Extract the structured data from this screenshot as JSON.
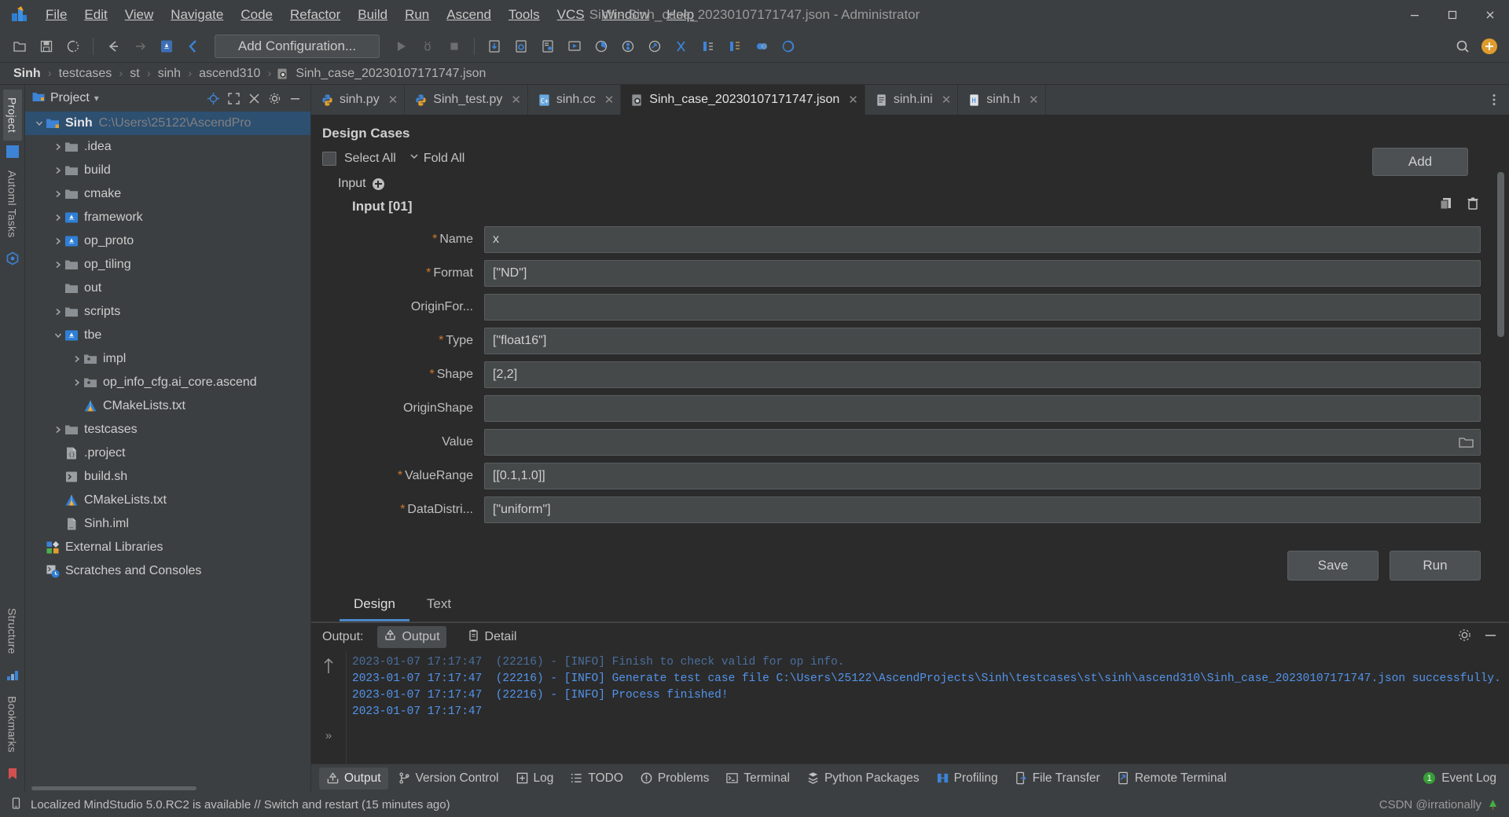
{
  "window": {
    "title": "Sinh - Sinh_case_20230107171747.json - Administrator",
    "minimize": "─",
    "maximize": "☐",
    "close": "✕"
  },
  "menu": [
    {
      "label": "File"
    },
    {
      "label": "Edit"
    },
    {
      "label": "View"
    },
    {
      "label": "Navigate"
    },
    {
      "label": "Code"
    },
    {
      "label": "Refactor"
    },
    {
      "label": "Build"
    },
    {
      "label": "Run"
    },
    {
      "label": "Ascend"
    },
    {
      "label": "Tools"
    },
    {
      "label": "VCS"
    },
    {
      "label": "Window"
    },
    {
      "label": "Help"
    }
  ],
  "toolbar": {
    "run_config": "Add Configuration...",
    "icons": [
      "open-project-icon",
      "save-all-icon",
      "sync-icon",
      "back-arrow-icon",
      "forward-arrow-icon",
      "ascend-project-icon",
      "build-hammer-icon"
    ],
    "right_icons": [
      "search-everywhere-icon",
      "ide-account-icon"
    ]
  },
  "breadcrumb": {
    "items": [
      "Sinh",
      "testcases",
      "st",
      "sinh",
      "ascend310",
      "Sinh_case_20230107171747.json"
    ],
    "separator": "›"
  },
  "left_rail": {
    "project_tab": "Project",
    "automl_tab": "Automl Tasks",
    "structure_tab": "Structure",
    "bookmarks_tab": "Bookmarks"
  },
  "project_pane": {
    "title": "Project",
    "dropdown": "▾",
    "header_icons": [
      "locate-icon",
      "expand-icon",
      "collapse-all-icon",
      "settings-gear-icon",
      "hide-icon"
    ],
    "tree": [
      {
        "label": "Sinh",
        "path": "C:\\Users\\25122\\AscendPro",
        "indent": 0,
        "arrow": "down",
        "icon": "module-folder-icon",
        "selected": true,
        "bold": true
      },
      {
        "label": ".idea",
        "indent": 1,
        "arrow": "right",
        "icon": "folder-icon"
      },
      {
        "label": "build",
        "indent": 1,
        "arrow": "right",
        "icon": "folder-icon"
      },
      {
        "label": "cmake",
        "indent": 1,
        "arrow": "right",
        "icon": "folder-icon"
      },
      {
        "label": "framework",
        "indent": 1,
        "arrow": "right",
        "icon": "source-root-icon"
      },
      {
        "label": "op_proto",
        "indent": 1,
        "arrow": "right",
        "icon": "source-root-icon"
      },
      {
        "label": "op_tiling",
        "indent": 1,
        "arrow": "right",
        "icon": "folder-icon"
      },
      {
        "label": "out",
        "indent": 1,
        "arrow": "none",
        "icon": "folder-icon"
      },
      {
        "label": "scripts",
        "indent": 1,
        "arrow": "right",
        "icon": "folder-icon"
      },
      {
        "label": "tbe",
        "indent": 1,
        "arrow": "down",
        "icon": "source-root-icon"
      },
      {
        "label": "impl",
        "indent": 2,
        "arrow": "right",
        "icon": "package-folder-icon"
      },
      {
        "label": "op_info_cfg.ai_core.ascend",
        "indent": 2,
        "arrow": "right",
        "icon": "package-folder-icon"
      },
      {
        "label": "CMakeLists.txt",
        "indent": 2,
        "arrow": "none",
        "icon": "cmake-file-icon"
      },
      {
        "label": "testcases",
        "indent": 1,
        "arrow": "right",
        "icon": "folder-icon"
      },
      {
        "label": ".project",
        "indent": 1,
        "arrow": "none",
        "icon": "xml-file-icon"
      },
      {
        "label": "build.sh",
        "indent": 1,
        "arrow": "none",
        "icon": "shell-file-icon"
      },
      {
        "label": "CMakeLists.txt",
        "indent": 1,
        "arrow": "none",
        "icon": "cmake-file-icon"
      },
      {
        "label": "Sinh.iml",
        "indent": 1,
        "arrow": "none",
        "icon": "iml-file-icon"
      },
      {
        "label": "External Libraries",
        "indent": 0,
        "arrow": "none",
        "icon": "external-libraries-icon"
      },
      {
        "label": "Scratches and Consoles",
        "indent": 0,
        "arrow": "none",
        "icon": "scratches-icon"
      }
    ]
  },
  "editor_tabs": [
    {
      "label": "sinh.py",
      "icon": "python-file-icon",
      "active": false
    },
    {
      "label": "Sinh_test.py",
      "icon": "python-file-icon",
      "active": false
    },
    {
      "label": "sinh.cc",
      "icon": "cpp-file-icon",
      "active": false
    },
    {
      "label": "Sinh_case_20230107171747.json",
      "icon": "ascend-json-icon",
      "active": true
    },
    {
      "label": "sinh.ini",
      "icon": "ini-file-icon",
      "active": false
    },
    {
      "label": "sinh.h",
      "icon": "header-file-icon",
      "active": false
    }
  ],
  "design": {
    "title": "Design Cases",
    "select_all": "Select All",
    "fold_all": "Fold All",
    "add_button": "Add",
    "group_label": "Input",
    "block_title": "Input [01]",
    "fields": [
      {
        "label": "Name",
        "required": true,
        "value": "x",
        "has_browse": false
      },
      {
        "label": "Format",
        "required": true,
        "value": "[\"ND\"]",
        "has_browse": false
      },
      {
        "label": "OriginFor...",
        "required": false,
        "value": "",
        "has_browse": false
      },
      {
        "label": "Type",
        "required": true,
        "value": "[\"float16\"]",
        "has_browse": false
      },
      {
        "label": "Shape",
        "required": true,
        "value": "[2,2]",
        "has_browse": false
      },
      {
        "label": "OriginShape",
        "required": false,
        "value": "",
        "has_browse": false
      },
      {
        "label": "Value",
        "required": false,
        "value": "",
        "has_browse": true
      },
      {
        "label": "ValueRange",
        "required": true,
        "value": "[[0.1,1.0]]",
        "has_browse": false
      },
      {
        "label": "DataDistri...",
        "required": true,
        "value": "[\"uniform\"]",
        "has_browse": false
      }
    ],
    "save_button": "Save",
    "run_button": "Run",
    "view_tabs": [
      {
        "label": "Design",
        "active": true
      },
      {
        "label": "Text",
        "active": false
      }
    ]
  },
  "output": {
    "label": "Output:",
    "tab_output": "Output",
    "tab_detail": "Detail",
    "lines": [
      {
        "text": "2023-01-07 17:17:47  (22216) - [INFO] Finish to check valid for op info.",
        "dim": true
      },
      {
        "text": "2023-01-07 17:17:47  (22216) - [INFO] Generate test case file C:\\Users\\25122\\AscendProjects\\Sinh\\testcases\\st\\sinh\\ascend310\\Sinh_case_20230107171747.json successfully.",
        "dim": false
      },
      {
        "text": "2023-01-07 17:17:47  (22216) - [INFO] Process finished!",
        "dim": false
      },
      {
        "text": "2023-01-07 17:17:47",
        "dim": false
      }
    ],
    "gutter_chevrons": "»",
    "right_icons": [
      "settings-gear-icon",
      "hide-panel-icon"
    ]
  },
  "bottom_tabs": [
    {
      "label": "Output",
      "icon": "output-arrow-icon",
      "active": true
    },
    {
      "label": "Version Control",
      "icon": "branch-icon",
      "active": false
    },
    {
      "label": "Log",
      "icon": "log-icon",
      "active": false
    },
    {
      "label": "TODO",
      "icon": "todo-list-icon",
      "active": false
    },
    {
      "label": "Problems",
      "icon": "problems-icon",
      "active": false
    },
    {
      "label": "Terminal",
      "icon": "terminal-icon",
      "active": false
    },
    {
      "label": "Python Packages",
      "icon": "python-packages-icon",
      "active": false
    },
    {
      "label": "Profiling",
      "icon": "profiling-icon",
      "active": false
    },
    {
      "label": "File Transfer",
      "icon": "file-transfer-icon",
      "active": false
    },
    {
      "label": "Remote Terminal",
      "icon": "remote-terminal-icon",
      "active": false
    }
  ],
  "event_log": {
    "label": "Event Log",
    "badge": "1"
  },
  "statusbar": {
    "message": "Localized MindStudio 5.0.RC2 is available // Switch and restart (15 minutes ago)",
    "watermark": "CSDN @irrationally"
  },
  "colors": {
    "accent_blue": "#4a88c7",
    "required_orange": "#cc7832",
    "console_blue": "#5394ec",
    "selection_blue": "#2d4f70",
    "panel_bg": "#3c3f41",
    "editor_bg": "#2b2b2b"
  }
}
